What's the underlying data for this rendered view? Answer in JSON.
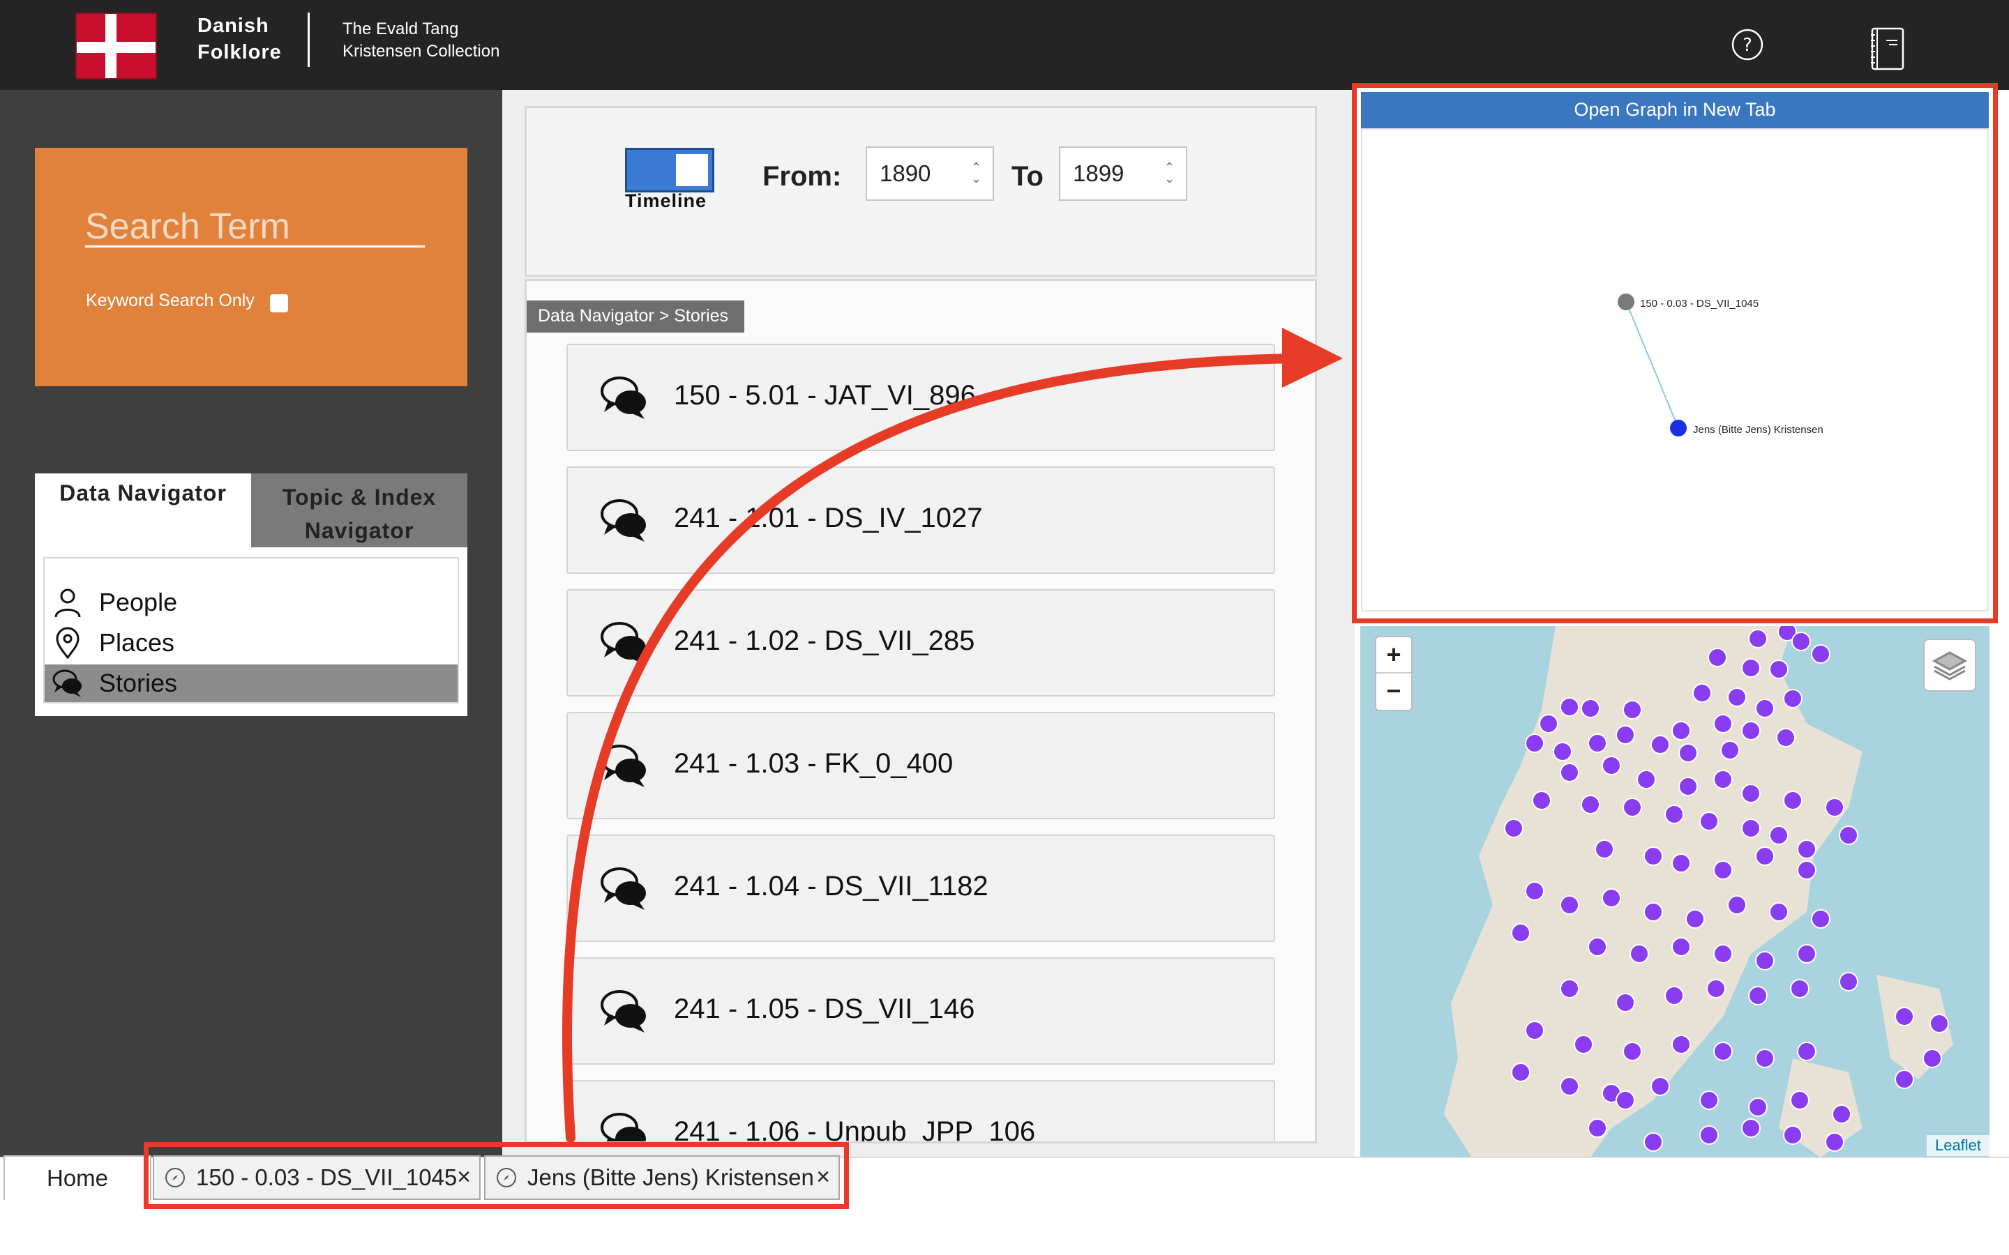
{
  "header": {
    "brand_line1": "Danish",
    "brand_line2": "Folklore",
    "subtitle_line1": "The Evald Tang",
    "subtitle_line2": "Kristensen Collection",
    "icons": [
      "flag-icon",
      "help-icon",
      "book-icon"
    ]
  },
  "search": {
    "placeholder": "Search Term",
    "keyword_only_label": "Keyword Search Only"
  },
  "navigator": {
    "tabs": [
      {
        "label": "Data Navigator",
        "active": true
      },
      {
        "label": "Topic & Index Navigator",
        "active": false
      }
    ],
    "items": [
      {
        "label": "People",
        "icon": "person-icon"
      },
      {
        "label": "Places",
        "icon": "map-pin-icon"
      },
      {
        "label": "Stories",
        "icon": "speech-bubbles-icon",
        "active": true
      }
    ]
  },
  "timeline": {
    "toggle_label": "Timeline",
    "toggle_on": true,
    "from_label": "From:",
    "from_value": "1890",
    "to_label": "To",
    "to_value": "1899"
  },
  "stories": {
    "breadcrumb": "Data Navigator > Stories",
    "items": [
      "150 - 5.01 - JAT_VI_896",
      "241 - 1.01 - DS_IV_1027",
      "241 - 1.02 - DS_VII_285",
      "241 - 1.03 - FK_0_400",
      "241 - 1.04 - DS_VII_1182",
      "241 - 1.05 - DS_VII_146",
      "241 - 1.06 - Unpub_JPP_106"
    ]
  },
  "graph": {
    "header": "Open Graph in New Tab",
    "nodes": [
      {
        "label": "150 - 0.03 - DS_VII_1045",
        "color": "#7a7a7a"
      },
      {
        "label": "Jens (Bitte Jens) Kristensen",
        "color": "#1a2fe0"
      }
    ],
    "edge_color": "#8fc7e8"
  },
  "map": {
    "zoom_in": "+",
    "zoom_out": "−",
    "attribution": "Leaflet",
    "marker_color": "#8a3cf0"
  },
  "tabs": {
    "home": "Home",
    "open": [
      {
        "label": "150 - 0.03 - DS_VII_1045",
        "close": "×"
      },
      {
        "label": "Jens (Bitte Jens) Kristensen",
        "close": "×"
      }
    ]
  },
  "colors": {
    "header_bg": "#242424",
    "search_bg": "#e0823b",
    "annotation": "#e63b26",
    "graph_header": "#3b77c0"
  }
}
